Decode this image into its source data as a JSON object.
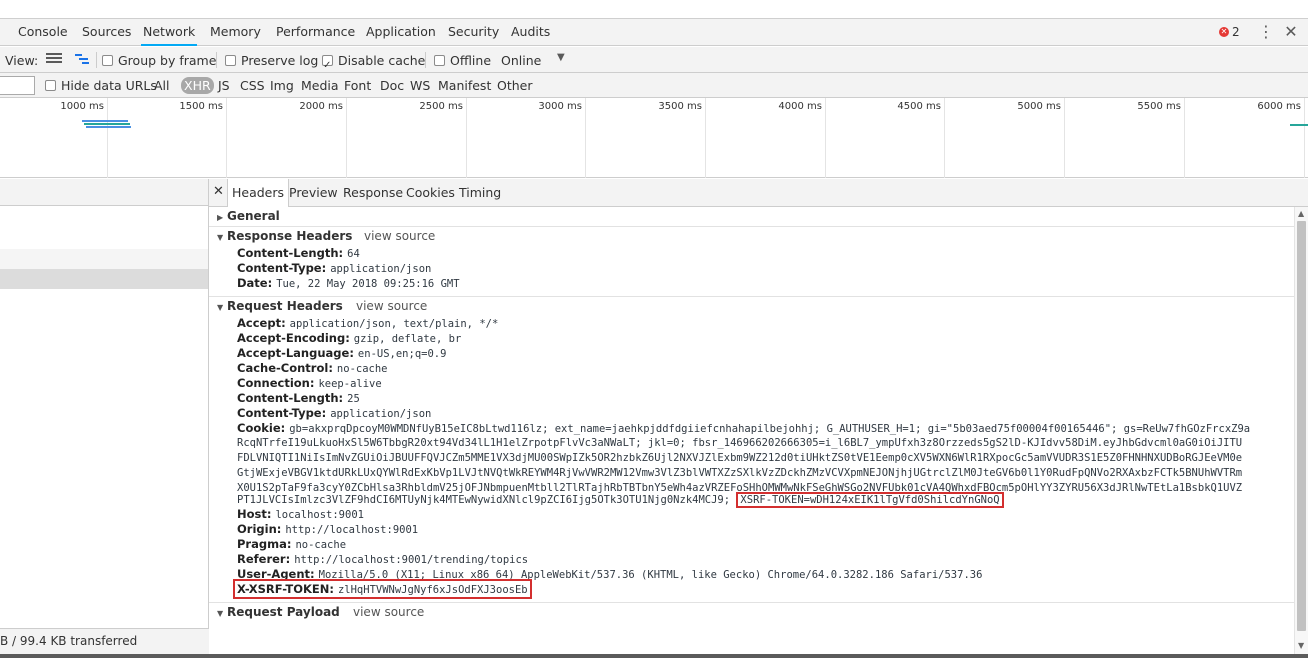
{
  "tabs": [
    "Console",
    "Sources",
    "Network",
    "Memory",
    "Performance",
    "Application",
    "Security",
    "Audits"
  ],
  "active_tab": "Network",
  "error_count": "2",
  "toolbar": {
    "view_label": "View:",
    "group_by_frame": "Group by frame",
    "preserve_log": "Preserve log",
    "disable_cache": "Disable cache",
    "offline": "Offline",
    "online": "Online"
  },
  "filter": {
    "hide_data_urls": "Hide data URLs",
    "types": [
      "All",
      "XHR",
      "JS",
      "CSS",
      "Img",
      "Media",
      "Font",
      "Doc",
      "WS",
      "Manifest",
      "Other"
    ],
    "active_type": "XHR"
  },
  "timeline": {
    "ticks": [
      "1000 ms",
      "1500 ms",
      "2000 ms",
      "2500 ms",
      "3000 ms",
      "3500 ms",
      "4000 ms",
      "4500 ms",
      "5000 ms",
      "5500 ms",
      "6000 ms"
    ]
  },
  "status_bar": "B / 99.4 KB transferred",
  "detail": {
    "tabs": [
      "Headers",
      "Preview",
      "Response",
      "Cookies",
      "Timing"
    ],
    "active_tab": "Headers",
    "general_label": "General",
    "response_headers_label": "Response Headers",
    "request_headers_label": "Request Headers",
    "request_payload_label": "Request Payload",
    "view_source": "view source",
    "response_headers": [
      {
        "name": "Content-Length:",
        "value": "64"
      },
      {
        "name": "Content-Type:",
        "value": "application/json"
      },
      {
        "name": "Date:",
        "value": "Tue, 22 May 2018 09:25:16 GMT"
      }
    ],
    "request_headers_top": [
      {
        "name": "Accept:",
        "value": "application/json, text/plain, */*"
      },
      {
        "name": "Accept-Encoding:",
        "value": "gzip, deflate, br"
      },
      {
        "name": "Accept-Language:",
        "value": "en-US,en;q=0.9"
      },
      {
        "name": "Cache-Control:",
        "value": "no-cache"
      },
      {
        "name": "Connection:",
        "value": "keep-alive"
      },
      {
        "name": "Content-Length:",
        "value": "25"
      },
      {
        "name": "Content-Type:",
        "value": "application/json"
      }
    ],
    "cookie_name": "Cookie:",
    "cookie_lines": [
      "gb=akxprqDpcoyM0WMDNfUyB15eIC8bLtwd116lz; ext_name=jaehkpjddfdgiiefcnhahapilbejohhj; G_AUTHUSER_H=1; gi=\"5b03aed75f00004f00165446\"; gs=ReUw7fhGOzFrcxZ9a",
      "RcqNTrfeI19uLkuoHxSl5W6TbbgR20xt94Vd34lL1H1elZrpotpFlvVc3aNWaLT; jkl=0; fbsr_146966202666305=i_l6BL7_ympUfxh3z8Orzzeds5gS2lD-KJIdvv58DiM.eyJhbGdvcml0aG0iOiJITU",
      "FDLVNIQTI1NiIsImNvZGUiOiJBUUFFQVJCZm5MME1VX3djMU00SWpIZk5OR2hzbkZ6Ujl2NXVJZlExbm9WZ212d0tiUHktZS0tVE1Eemp0cXV5WXN6WlR1RXpocGc5amVVUDR3S1E5Z0FHNHNXUDBoRGJEeVM0e",
      "GtjWExjeVBGV1ktdURkLUxQYWlRdExKbVp1LVJtNVQtWkREYWM4RjVwVWR2MW12Vmw3VlZ3blVWTXZzSXlkVzZDckhZMzVCVXpmNEJONjhjUGtrclZlM0JteGV6b0l1Y0RudFpQNVo2RXAxbzFCTk5BNUhWVTRm",
      "X0U1S2pTaF9fa3cyY0ZCbHlsa3RhbldmV25jOFJNbmpuenMtbll2TlRTajhRbTBTbnY5eWh4azVRZEFoSHhOMWMwNkFSeGhWSGo2NVFUbk01cVA4QWhxdFBOcm5pOHlYY3ZYRU56X3dJRlNwTEtLa1BsbkQ1UVZ",
      "PT1JLVCIsImlzc3VlZF9hdCI6MTUyNjk4MTEwNywidXNlcl9pZCI6Ijg5OTk3OTU1Njg0Nzk4MCJ9;"
    ],
    "xsrf_cookie": "XSRF-TOKEN=wDH124xEIK1lTgVfd0ShilcdYnGNoQ",
    "request_headers_bottom": [
      {
        "name": "Host:",
        "value": "localhost:9001"
      },
      {
        "name": "Origin:",
        "value": "http://localhost:9001"
      },
      {
        "name": "Pragma:",
        "value": "no-cache"
      },
      {
        "name": "Referer:",
        "value": "http://localhost:9001/trending/topics"
      },
      {
        "name": "User-Agent:",
        "value": "Mozilla/5.0 (X11; Linux x86_64) AppleWebKit/537.36 (KHTML, like Gecko) Chrome/64.0.3282.186 Safari/537.36"
      }
    ],
    "xsrf_header": {
      "name": "X-XSRF-TOKEN:",
      "value": "zlHqHTVWNwJgNyf6xJsOdFXJ3oosEb"
    }
  },
  "colors": {
    "accent": "#03a9f4",
    "highlight_box": "#d32f2f",
    "error": "#e53935"
  }
}
